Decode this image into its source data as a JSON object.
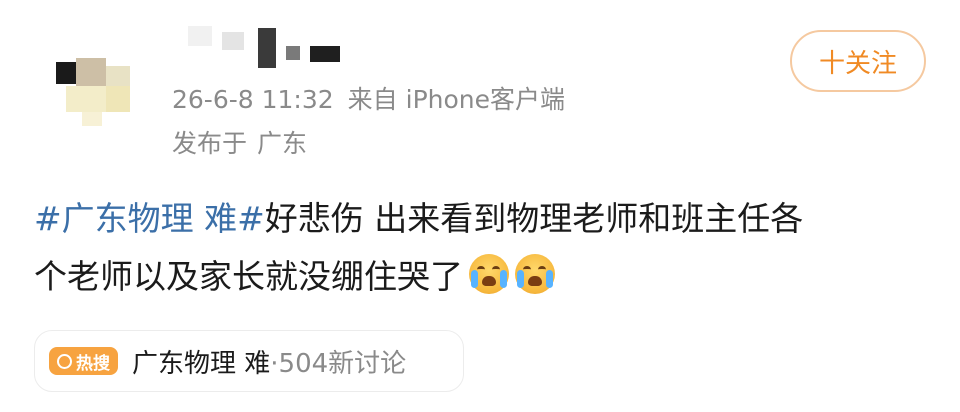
{
  "post": {
    "meta": {
      "time": "26-6-8 11:32",
      "source": "来自 iPhone客户端",
      "location_prefix": "发布于",
      "location": "广东"
    },
    "follow_label": "十关注",
    "text": {
      "hashtag": "#广东物理 难#",
      "body_line1": "好悲伤 出来看到物理老师和班主任各",
      "body_line2": "个老师以及家长就没绷住哭了"
    },
    "emoji_icons": [
      "loudly-crying-face-icon",
      "loudly-crying-face-icon"
    ]
  },
  "topic_card": {
    "badge": "热搜",
    "title": "广东物理 难",
    "count": "·504新讨论"
  },
  "colors": {
    "accent": "#f08a24",
    "hashtag": "#3b6fa8",
    "muted": "#8a8a8a",
    "badge_bg": "#f7a340"
  }
}
